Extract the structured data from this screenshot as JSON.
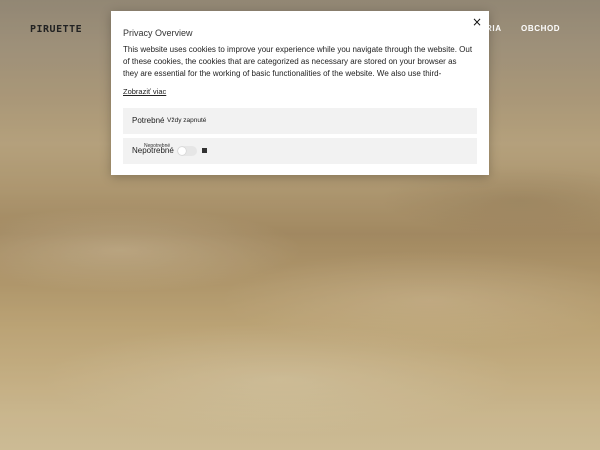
{
  "header": {
    "logo_text": "PIRUETTE",
    "nav": [
      "RIA",
      "OBCHOD"
    ]
  },
  "modal": {
    "title": "Privacy Overview",
    "close_label": "×",
    "description": "This website uses cookies to improve your experience while you navigate through the website. Out of these cookies, the cookies that are categorized as necessary are stored on your browser as they are essential for the working of basic functionalities of the website. We also use third-",
    "show_more": "Zobraziť viac",
    "categories": [
      {
        "label": "Potrebné",
        "status": "Vždy zapnuté"
      },
      {
        "label": "Nepotrebné",
        "toggle_label": "Nepotrebné",
        "enabled": false
      }
    ]
  }
}
